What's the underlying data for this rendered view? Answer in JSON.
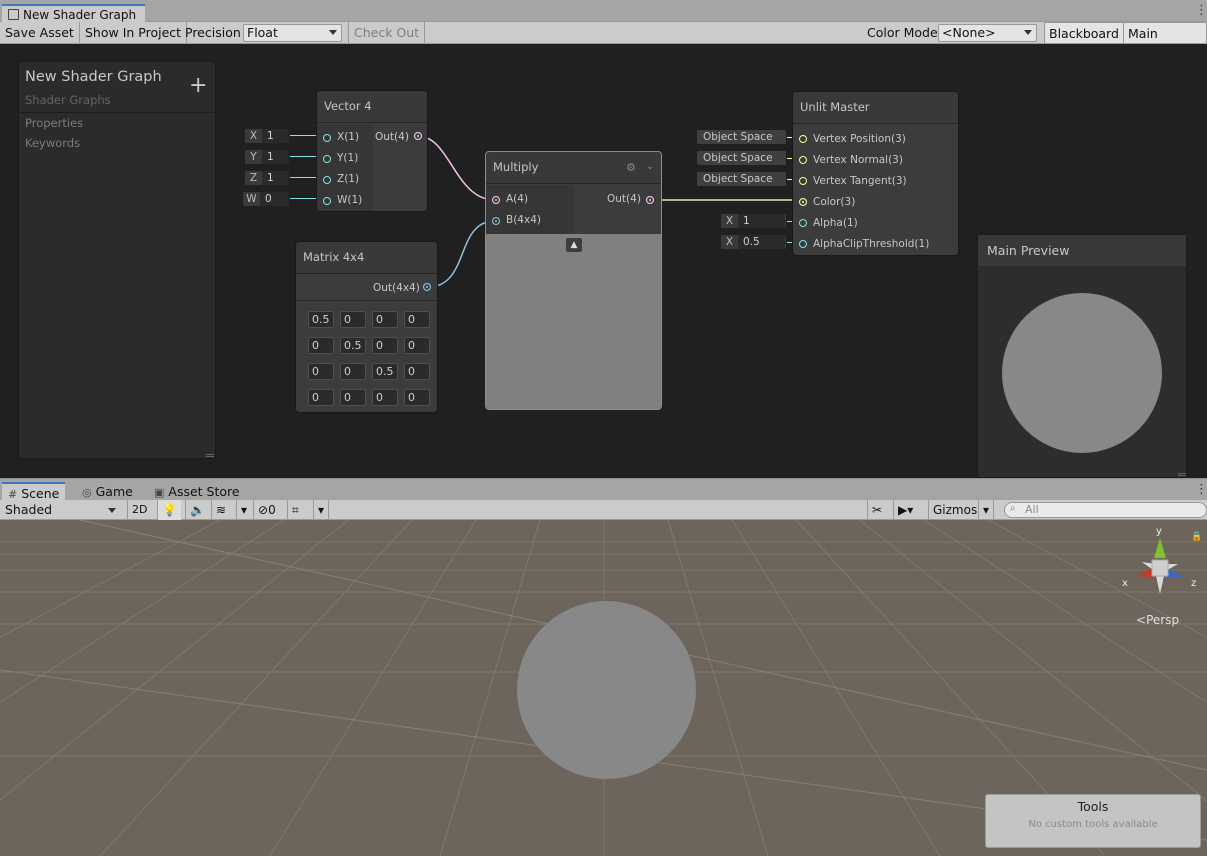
{
  "window": {
    "tab_title": "New Shader Graph"
  },
  "toolbar": {
    "save_asset": "Save Asset",
    "show_in_project": "Show In Project",
    "precision_label": "Precision",
    "precision_value": "Float",
    "check_out": "Check Out",
    "color_mode_label": "Color Mode",
    "color_mode_value": "<None>",
    "blackboard": "Blackboard",
    "main_preview": "Main Preview"
  },
  "blackboard": {
    "title": "New Shader Graph",
    "subtitle": "Shader Graphs",
    "add_symbol": "+",
    "sections": [
      "Properties",
      "Keywords"
    ]
  },
  "vector4_node": {
    "title": "Vector 4",
    "inputs": [
      {
        "axis": "X",
        "value": "1",
        "port": "X(1)"
      },
      {
        "axis": "Y",
        "value": "1",
        "port": "Y(1)"
      },
      {
        "axis": "Z",
        "value": "1",
        "port": "Z(1)"
      },
      {
        "axis": "W",
        "value": "0",
        "port": "W(1)"
      }
    ],
    "output": "Out(4)"
  },
  "matrix_node": {
    "title": "Matrix 4x4",
    "output": "Out(4x4)",
    "rows": [
      [
        "0.5",
        "0",
        "0",
        "0"
      ],
      [
        "0",
        "0.5",
        "0",
        "0"
      ],
      [
        "0",
        "0",
        "0.5",
        "0"
      ],
      [
        "0",
        "0",
        "0",
        "0"
      ]
    ]
  },
  "multiply_node": {
    "title": "Multiply",
    "inputs": [
      "A(4)",
      "B(4x4)"
    ],
    "output": "Out(4)"
  },
  "master_node": {
    "title": "Unlit Master",
    "ports": [
      {
        "field": "Object Space",
        "label": "Vertex Position(3)"
      },
      {
        "field": "Object Space",
        "label": "Vertex Normal(3)"
      },
      {
        "field": "Object Space",
        "label": "Vertex Tangent(3)"
      },
      {
        "field": "",
        "label": "Color(3)"
      },
      {
        "axis": "X",
        "value": "1",
        "label": "Alpha(1)"
      },
      {
        "axis": "X",
        "value": "0.5",
        "label": "AlphaClipThreshold(1)"
      }
    ]
  },
  "main_preview_panel": {
    "title": "Main Preview"
  },
  "scene": {
    "tabs": [
      "Scene",
      "Game",
      "Asset Store"
    ],
    "shading_mode": "Shaded",
    "mode_2d": "2D",
    "hidden_count": "0",
    "gizmos": "Gizmos",
    "search_placeholder": "All",
    "persp_label": "Persp",
    "axes": {
      "x": "x",
      "y": "y",
      "z": "z"
    },
    "tools_title": "Tools",
    "tools_message": "No custom tools available"
  },
  "colors": {
    "accent_tab": "#3a79bb",
    "vector4_port": "#fbcbf4",
    "matrix_port": "#8fc1df",
    "vector3_port": "#f6ff9a",
    "float_port": "#84e4e7",
    "graph_bg": "#202020",
    "scene_ground": "#6d645c"
  }
}
